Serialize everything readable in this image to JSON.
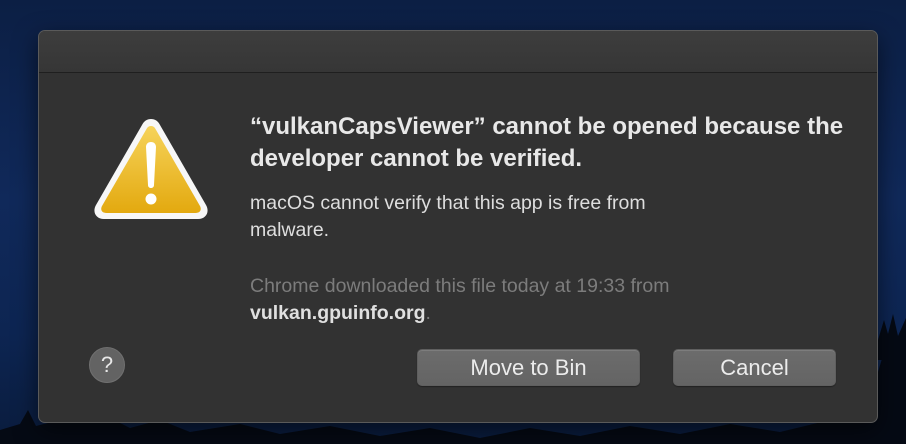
{
  "dialog": {
    "headline": "“vulkanCapsViewer” cannot be opened because the developer cannot be verified.",
    "message": "macOS cannot verify that this app is free from malware.",
    "source_text": "Chrome downloaded this file today at 19:33 from",
    "source_host": "vulkan.gpuinfo.org",
    "source_suffix": ".",
    "help_label": "?",
    "buttons": {
      "move_to_bin": "Move to Bin",
      "cancel": "Cancel"
    }
  },
  "icons": {
    "warning": "warning-triangle-icon",
    "help": "help-icon"
  },
  "colors": {
    "dialog_background": "#323232",
    "warning_yellow": "#f2c11d",
    "button_background": "#6a6a6a",
    "desktop_background": "#0e2550"
  }
}
